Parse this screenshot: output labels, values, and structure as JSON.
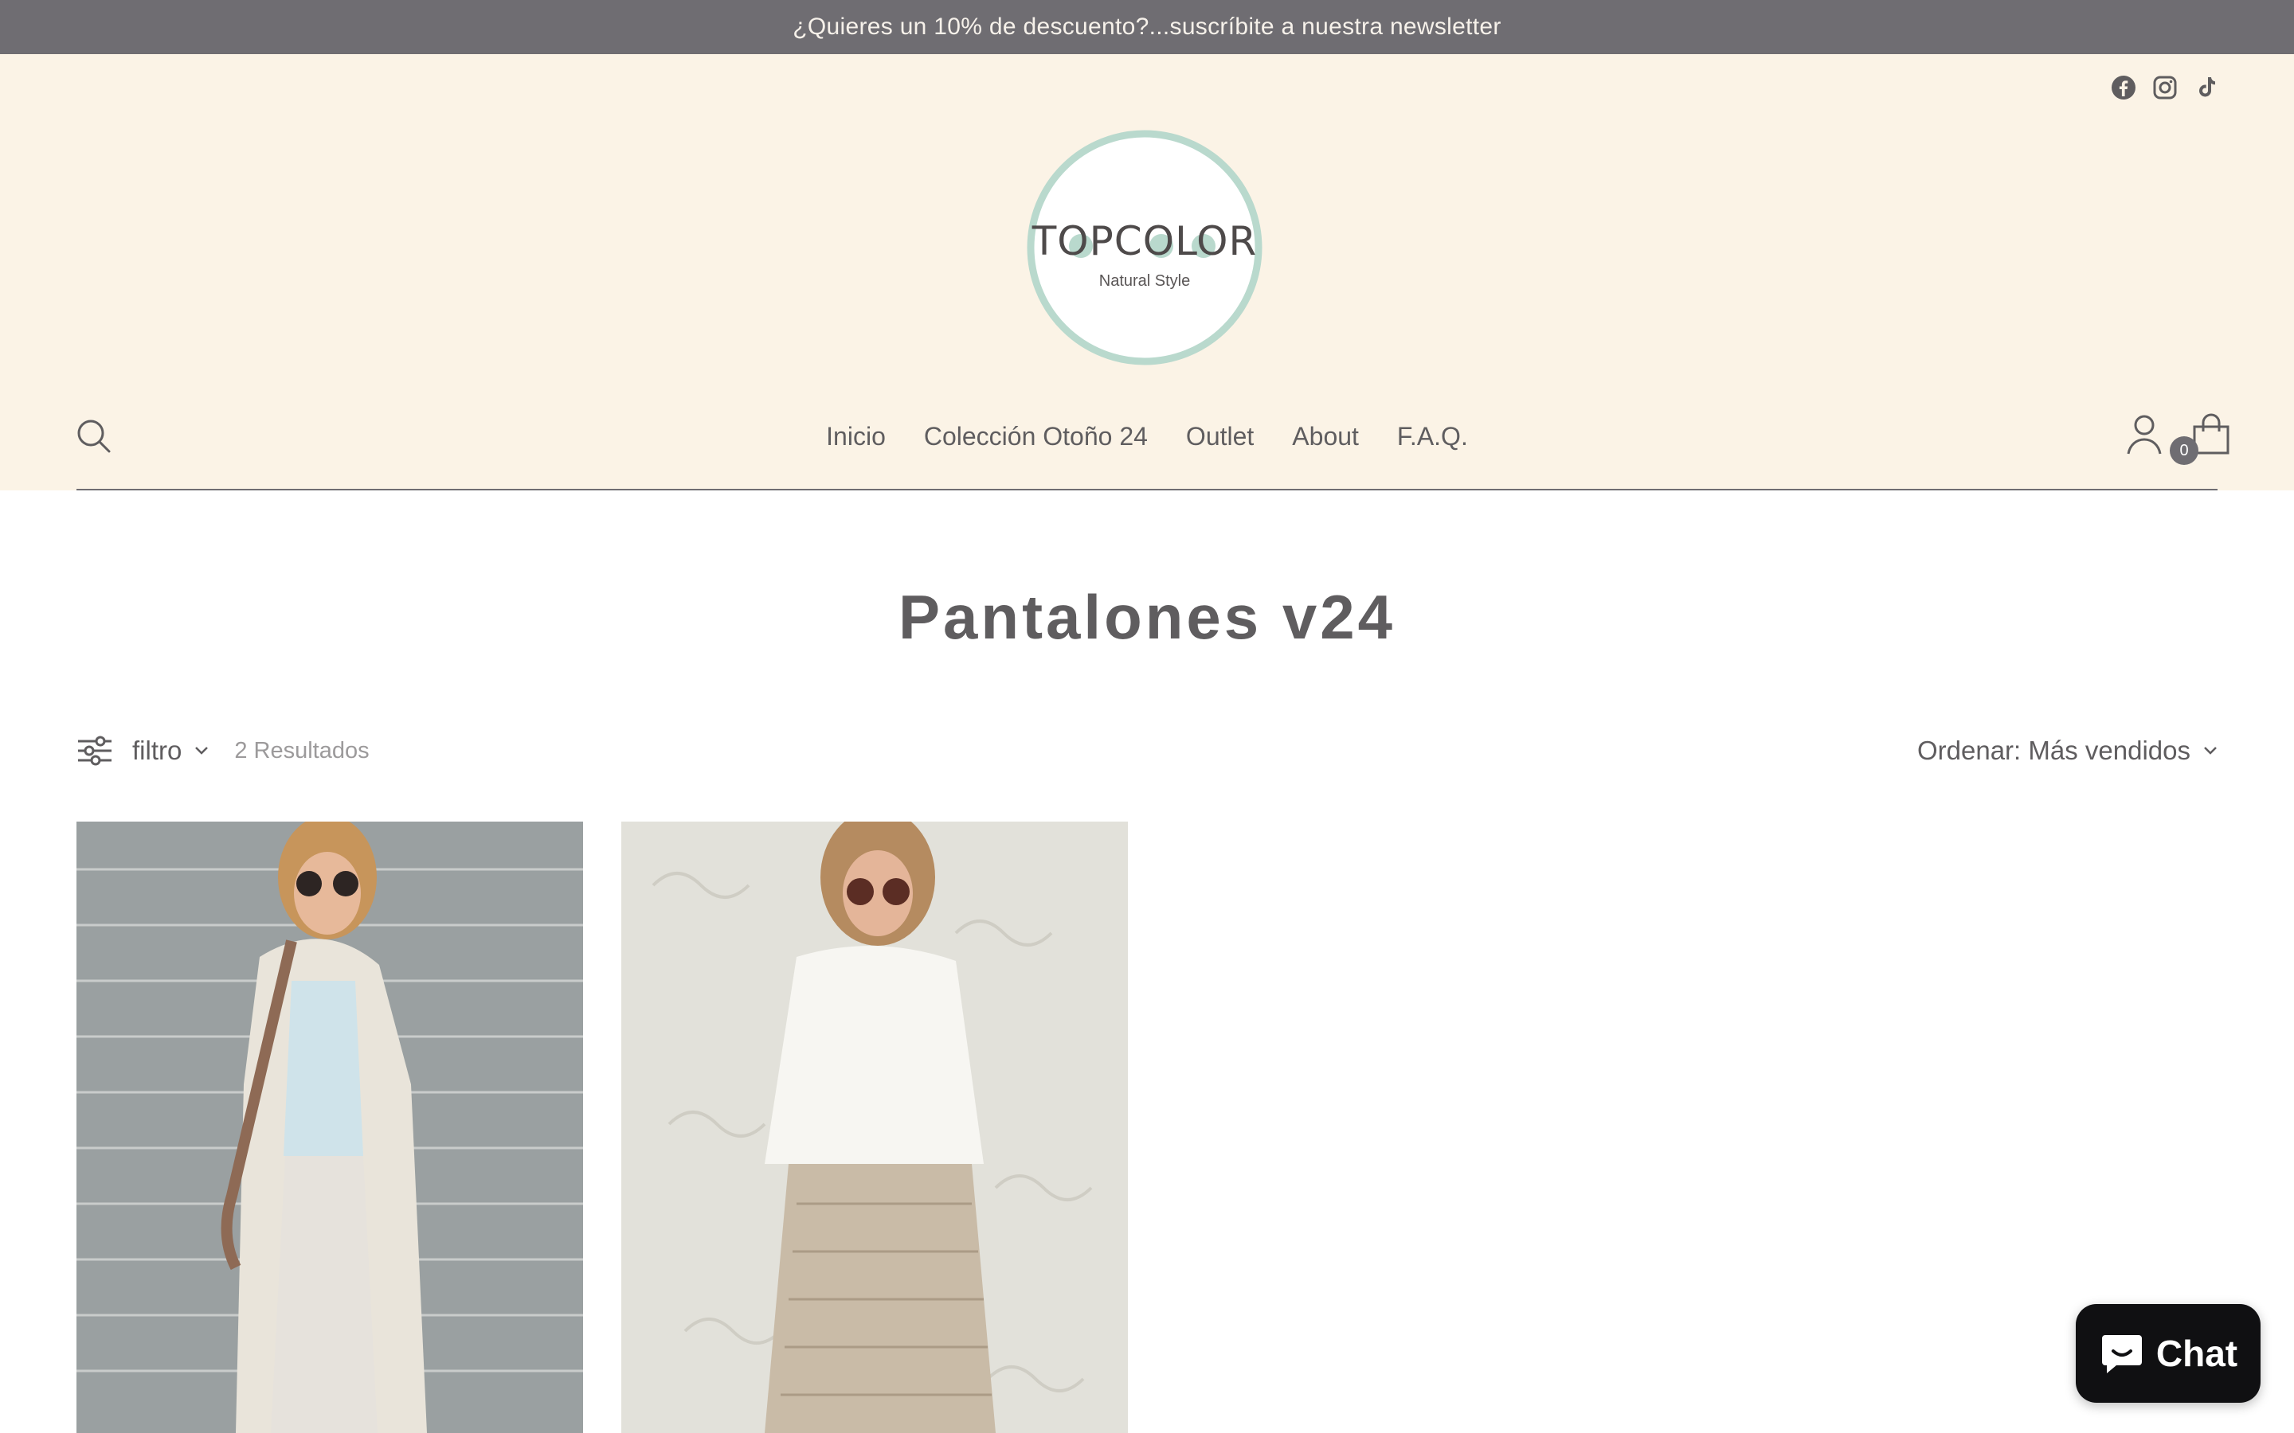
{
  "announcement": "¿Quieres un 10% de descuento?...suscríbite a nuestra newsletter",
  "header": {
    "social_icons": [
      "facebook-icon",
      "instagram-icon",
      "tiktok-icon"
    ],
    "logo": {
      "wordmark": "TOPCOLOR",
      "tagline": "Natural Style"
    },
    "nav": [
      "Inicio",
      "Colección Otoño 24",
      "Outlet",
      "About",
      "F.A.Q."
    ],
    "cart_count": "0"
  },
  "collection": {
    "title": "Pantalones v24",
    "filter_label": "filtro",
    "results": "2 Resultados",
    "sort_label": "Ordenar: Más vendidos"
  },
  "products": [
    {
      "image": "woman-in-linen-trousers-photo"
    },
    {
      "image": "woman-in-knit-trousers-photo"
    }
  ],
  "chat": {
    "label": "Chat"
  },
  "colors": {
    "announcement_bg": "#6f6d72",
    "header_bg": "#fbf3e6",
    "logo_ring": "#b9d9cd",
    "text": "#5f5d5f",
    "chat_bg": "#101012"
  }
}
